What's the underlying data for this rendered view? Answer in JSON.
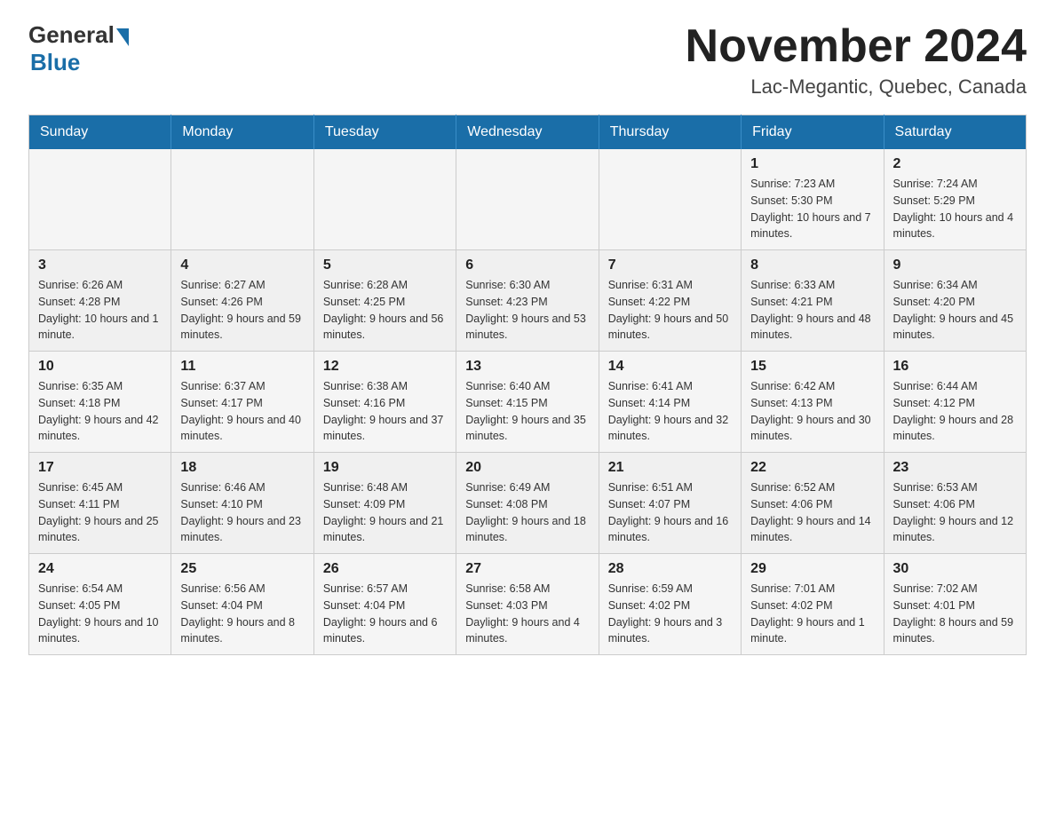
{
  "header": {
    "logo_general": "General",
    "logo_blue": "Blue",
    "month_title": "November 2024",
    "location": "Lac-Megantic, Quebec, Canada"
  },
  "weekdays": [
    "Sunday",
    "Monday",
    "Tuesday",
    "Wednesday",
    "Thursday",
    "Friday",
    "Saturday"
  ],
  "weeks": [
    [
      {
        "day": "",
        "info": ""
      },
      {
        "day": "",
        "info": ""
      },
      {
        "day": "",
        "info": ""
      },
      {
        "day": "",
        "info": ""
      },
      {
        "day": "",
        "info": ""
      },
      {
        "day": "1",
        "info": "Sunrise: 7:23 AM\nSunset: 5:30 PM\nDaylight: 10 hours and 7 minutes."
      },
      {
        "day": "2",
        "info": "Sunrise: 7:24 AM\nSunset: 5:29 PM\nDaylight: 10 hours and 4 minutes."
      }
    ],
    [
      {
        "day": "3",
        "info": "Sunrise: 6:26 AM\nSunset: 4:28 PM\nDaylight: 10 hours and 1 minute."
      },
      {
        "day": "4",
        "info": "Sunrise: 6:27 AM\nSunset: 4:26 PM\nDaylight: 9 hours and 59 minutes."
      },
      {
        "day": "5",
        "info": "Sunrise: 6:28 AM\nSunset: 4:25 PM\nDaylight: 9 hours and 56 minutes."
      },
      {
        "day": "6",
        "info": "Sunrise: 6:30 AM\nSunset: 4:23 PM\nDaylight: 9 hours and 53 minutes."
      },
      {
        "day": "7",
        "info": "Sunrise: 6:31 AM\nSunset: 4:22 PM\nDaylight: 9 hours and 50 minutes."
      },
      {
        "day": "8",
        "info": "Sunrise: 6:33 AM\nSunset: 4:21 PM\nDaylight: 9 hours and 48 minutes."
      },
      {
        "day": "9",
        "info": "Sunrise: 6:34 AM\nSunset: 4:20 PM\nDaylight: 9 hours and 45 minutes."
      }
    ],
    [
      {
        "day": "10",
        "info": "Sunrise: 6:35 AM\nSunset: 4:18 PM\nDaylight: 9 hours and 42 minutes."
      },
      {
        "day": "11",
        "info": "Sunrise: 6:37 AM\nSunset: 4:17 PM\nDaylight: 9 hours and 40 minutes."
      },
      {
        "day": "12",
        "info": "Sunrise: 6:38 AM\nSunset: 4:16 PM\nDaylight: 9 hours and 37 minutes."
      },
      {
        "day": "13",
        "info": "Sunrise: 6:40 AM\nSunset: 4:15 PM\nDaylight: 9 hours and 35 minutes."
      },
      {
        "day": "14",
        "info": "Sunrise: 6:41 AM\nSunset: 4:14 PM\nDaylight: 9 hours and 32 minutes."
      },
      {
        "day": "15",
        "info": "Sunrise: 6:42 AM\nSunset: 4:13 PM\nDaylight: 9 hours and 30 minutes."
      },
      {
        "day": "16",
        "info": "Sunrise: 6:44 AM\nSunset: 4:12 PM\nDaylight: 9 hours and 28 minutes."
      }
    ],
    [
      {
        "day": "17",
        "info": "Sunrise: 6:45 AM\nSunset: 4:11 PM\nDaylight: 9 hours and 25 minutes."
      },
      {
        "day": "18",
        "info": "Sunrise: 6:46 AM\nSunset: 4:10 PM\nDaylight: 9 hours and 23 minutes."
      },
      {
        "day": "19",
        "info": "Sunrise: 6:48 AM\nSunset: 4:09 PM\nDaylight: 9 hours and 21 minutes."
      },
      {
        "day": "20",
        "info": "Sunrise: 6:49 AM\nSunset: 4:08 PM\nDaylight: 9 hours and 18 minutes."
      },
      {
        "day": "21",
        "info": "Sunrise: 6:51 AM\nSunset: 4:07 PM\nDaylight: 9 hours and 16 minutes."
      },
      {
        "day": "22",
        "info": "Sunrise: 6:52 AM\nSunset: 4:06 PM\nDaylight: 9 hours and 14 minutes."
      },
      {
        "day": "23",
        "info": "Sunrise: 6:53 AM\nSunset: 4:06 PM\nDaylight: 9 hours and 12 minutes."
      }
    ],
    [
      {
        "day": "24",
        "info": "Sunrise: 6:54 AM\nSunset: 4:05 PM\nDaylight: 9 hours and 10 minutes."
      },
      {
        "day": "25",
        "info": "Sunrise: 6:56 AM\nSunset: 4:04 PM\nDaylight: 9 hours and 8 minutes."
      },
      {
        "day": "26",
        "info": "Sunrise: 6:57 AM\nSunset: 4:04 PM\nDaylight: 9 hours and 6 minutes."
      },
      {
        "day": "27",
        "info": "Sunrise: 6:58 AM\nSunset: 4:03 PM\nDaylight: 9 hours and 4 minutes."
      },
      {
        "day": "28",
        "info": "Sunrise: 6:59 AM\nSunset: 4:02 PM\nDaylight: 9 hours and 3 minutes."
      },
      {
        "day": "29",
        "info": "Sunrise: 7:01 AM\nSunset: 4:02 PM\nDaylight: 9 hours and 1 minute."
      },
      {
        "day": "30",
        "info": "Sunrise: 7:02 AM\nSunset: 4:01 PM\nDaylight: 8 hours and 59 minutes."
      }
    ]
  ]
}
